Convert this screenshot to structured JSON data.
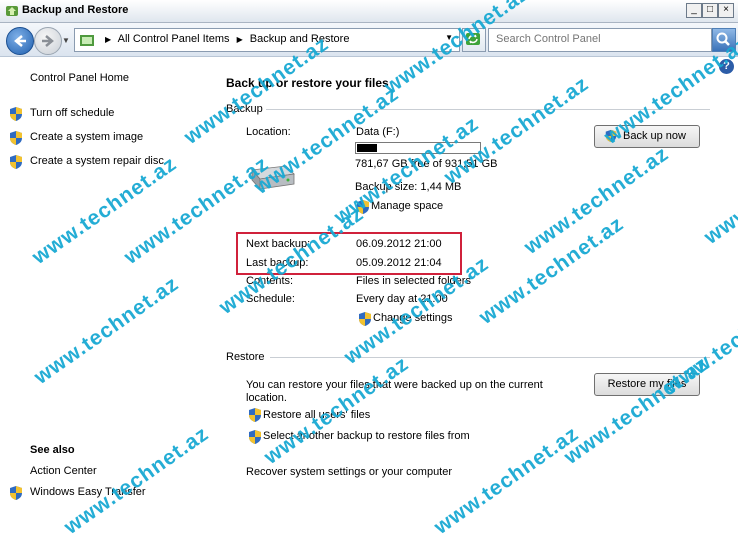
{
  "window": {
    "title": "Backup and Restore"
  },
  "address": {
    "crumbs": [
      "All Control Panel Items",
      "Backup and Restore"
    ],
    "search_placeholder": "Search Control Panel"
  },
  "left_pane": {
    "home": "Control Panel Home",
    "tasks": [
      "Turn off schedule",
      "Create a system image",
      "Create a system repair disc"
    ],
    "see_also_title": "See also",
    "see_also": [
      "Action Center",
      "Windows Easy Transfer"
    ]
  },
  "main": {
    "title": "Back up or restore your files",
    "backup": {
      "header": "Backup",
      "location_label": "Location:",
      "location_value": "Data (F:)",
      "used_fraction": 0.16,
      "free_text": "781,67 GB free of 931,51 GB",
      "backup_size": "Backup size: 1,44 MB",
      "manage_space": "Manage space",
      "back_up_now": "Back up now",
      "next_label": "Next backup:",
      "next_value": "06.09.2012 21:00",
      "last_label": "Last backup:",
      "last_value": "05.09.2012 21:04",
      "contents_label": "Contents:",
      "contents_value": "Files in selected folders",
      "schedule_label": "Schedule:",
      "schedule_value": "Every day at 21:00",
      "change_settings": "Change settings"
    },
    "restore": {
      "header": "Restore",
      "text": "You can restore your files that were backed up on the current location.",
      "restore_my_files": "Restore my files",
      "restore_all": "Restore all users' files",
      "select_another": "Select another backup to restore files from",
      "recover_system": "Recover system settings or your computer"
    }
  },
  "watermark": "www.technet.az",
  "colors": {
    "watermark": "#19a9d3",
    "highlight_box": "#d0213b"
  }
}
